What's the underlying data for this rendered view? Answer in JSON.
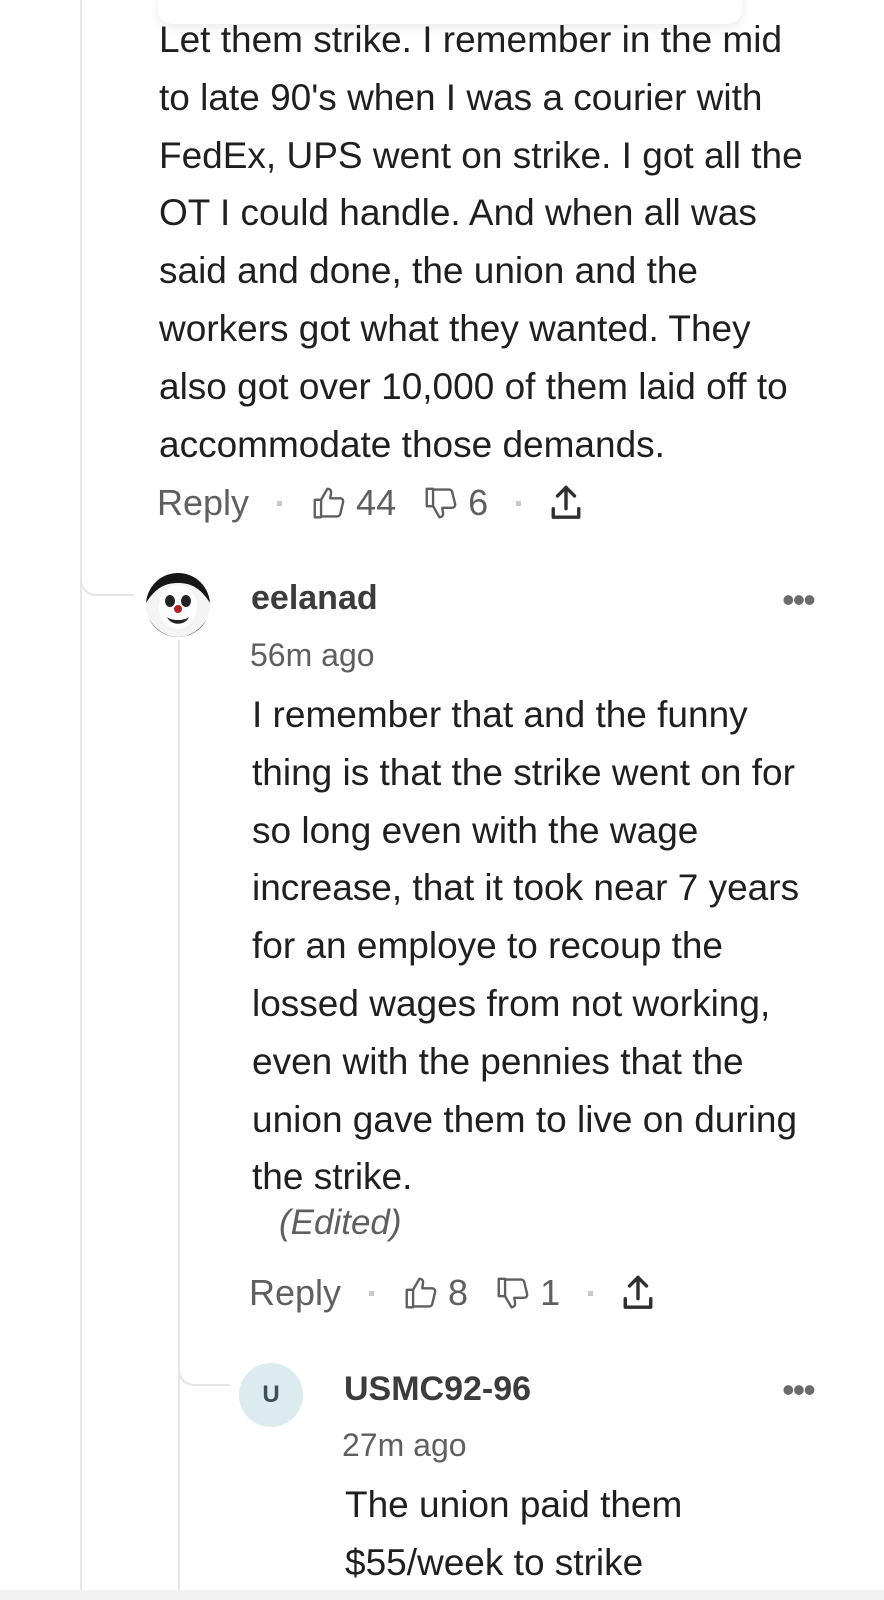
{
  "comments": [
    {
      "body": "Let them strike. I remember in the mid\nto late 90's when I was a courier with\nFedEx, UPS went on strike. I got all the\nOT I could handle. And when all was\nsaid and done, the union and the\nworkers got what they wanted. They\nalso got over 10,000 of them laid off to\naccommodate those demands.",
      "reply_label": "Reply",
      "likes": "44",
      "dislikes": "6"
    },
    {
      "username": "eelanad",
      "timestamp": "56m ago",
      "more": "•••",
      "body": "I remember that and the funny\nthing is that the strike went on for\nso long even with the wage\nincrease, that it took near 7 years\nfor an employe to recoup the\nlossed wages from not working,\neven with the pennies that the\nunion gave them to live on during\nthe strike.",
      "edited": "(Edited)",
      "reply_label": "Reply",
      "likes": "8",
      "dislikes": "1"
    },
    {
      "username": "USMC92-96",
      "avatar_letter": "U",
      "timestamp": "27m ago",
      "more": "•••",
      "body": "The union paid them\n$55/week to strike"
    }
  ],
  "colors": {
    "text": "#1f1f1f",
    "muted": "#5f5f5f",
    "thread_line": "#e6e6e6",
    "avatar_bg": "#dcecee"
  },
  "icons": [
    "thumbs-up-icon",
    "thumbs-down-icon",
    "share-icon",
    "more-icon"
  ]
}
